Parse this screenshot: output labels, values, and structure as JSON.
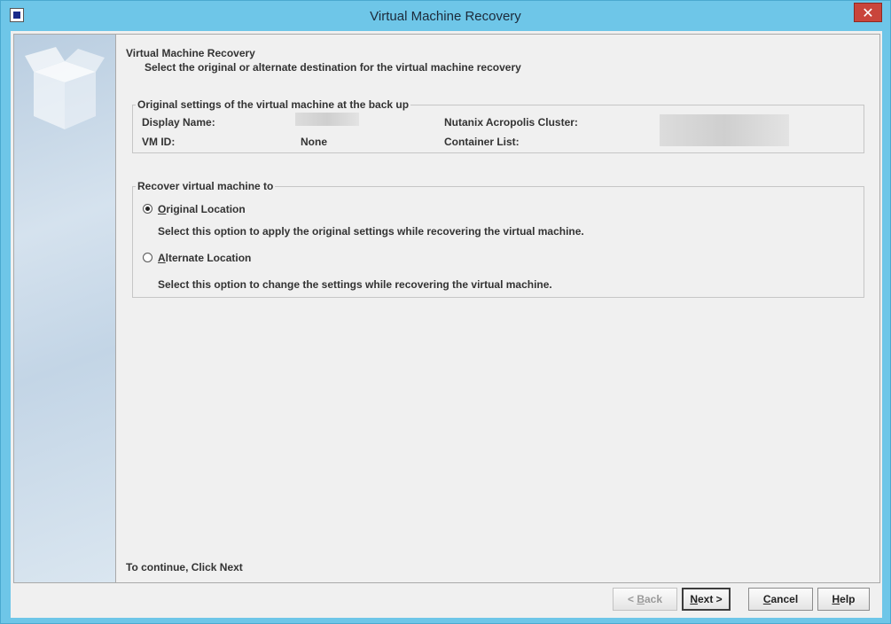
{
  "window": {
    "title": "Virtual Machine Recovery",
    "close_label": "✕"
  },
  "header": {
    "title": "Virtual Machine Recovery",
    "subtitle": "Select the original or alternate destination for the virtual machine recovery"
  },
  "original_settings": {
    "legend": "Original settings of the virtual machine at the back up",
    "display_name_label": "Display Name:",
    "vm_id_label": "VM ID:",
    "vm_id_value": "None",
    "cluster_label": "Nutanix Acropolis Cluster:",
    "container_list_label": "Container List:"
  },
  "recover_to": {
    "legend": "Recover virtual machine to",
    "original": {
      "accel": "O",
      "label_rest": "riginal Location",
      "description": "Select this option to apply the original settings while recovering the virtual machine.",
      "selected": true
    },
    "alternate": {
      "accel": "A",
      "label_rest": "lternate Location",
      "description": "Select this option to change the settings while recovering the virtual machine.",
      "selected": false
    }
  },
  "footer": {
    "hint": "To continue, Click Next"
  },
  "buttons": {
    "back_prefix": "< ",
    "back_accel": "B",
    "back_rest": "ack",
    "next_accel": "N",
    "next_rest": "ext >",
    "cancel_accel": "C",
    "cancel_rest": "ancel",
    "help_accel": "H",
    "help_rest": "elp"
  },
  "colors": {
    "titlebar": "#6ec6e8",
    "close_button": "#c9453b",
    "panel_background": "#f0f0f0"
  }
}
